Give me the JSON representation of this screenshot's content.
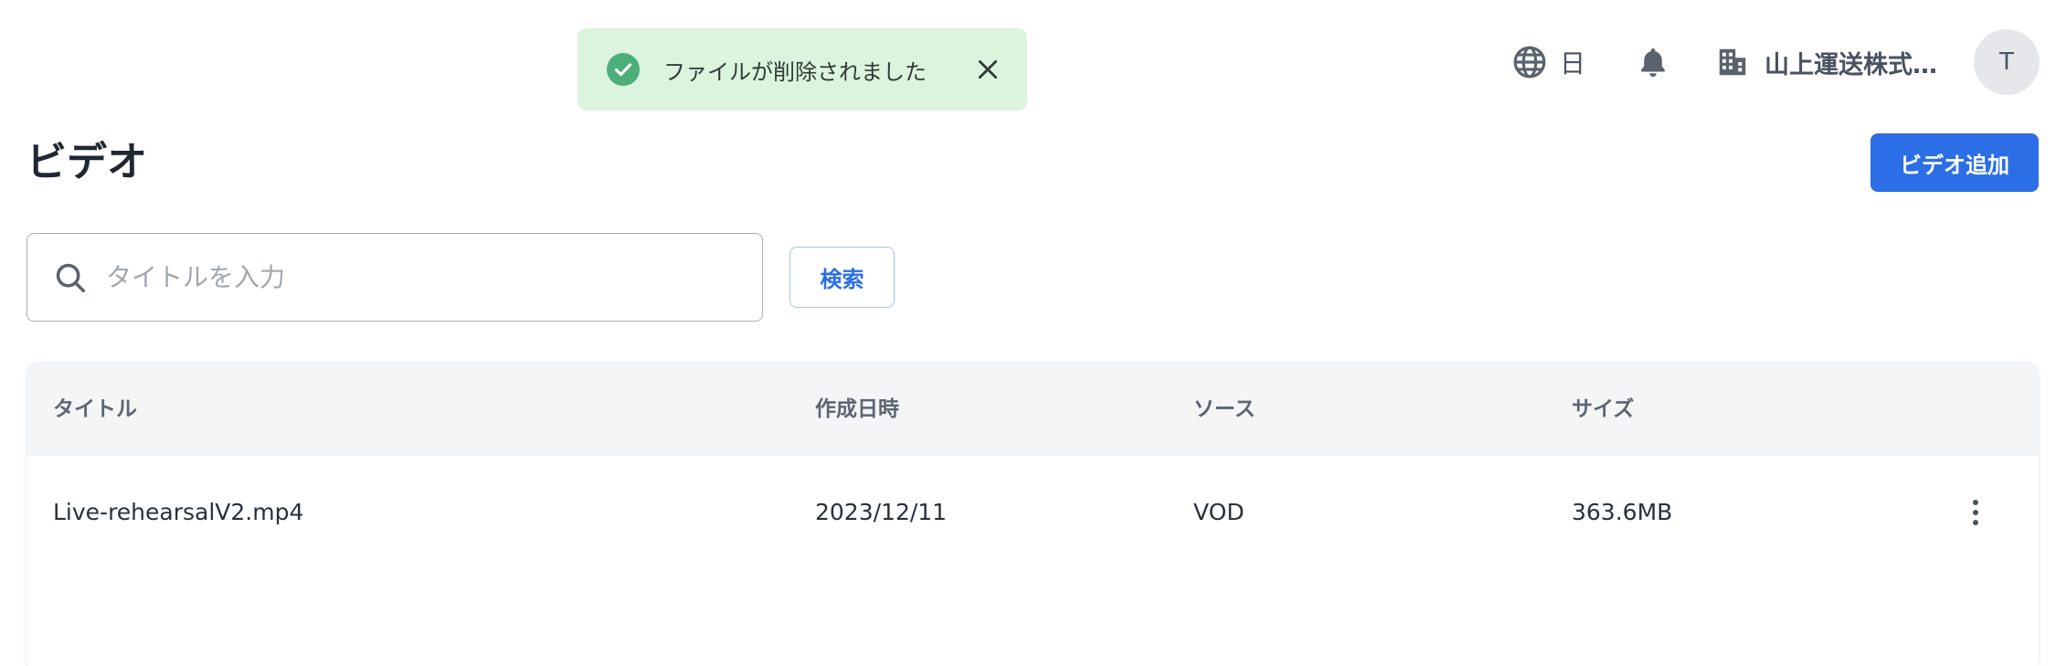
{
  "header": {
    "language_label": "日",
    "company_name": "山上運送株式…",
    "avatar_initial": "T"
  },
  "toast": {
    "message": "ファイルが削除されました",
    "status_color": "#4caf7a"
  },
  "page": {
    "title": "ビデオ",
    "add_button_label": "ビデオ追加"
  },
  "search": {
    "value": "",
    "placeholder": "タイトルを入力",
    "button_label": "検索"
  },
  "table": {
    "columns": [
      "タイトル",
      "作成日時",
      "ソース",
      "サイズ"
    ],
    "rows": [
      {
        "title": "Live-rehearsalV2.mp4",
        "created": "2023/12/11",
        "source": "VOD",
        "size": "363.6MB"
      }
    ]
  },
  "colors": {
    "accent": "#2b6ee6",
    "toast_bg": "#dcf3dd",
    "table_header_bg": "#f3f5f7"
  }
}
